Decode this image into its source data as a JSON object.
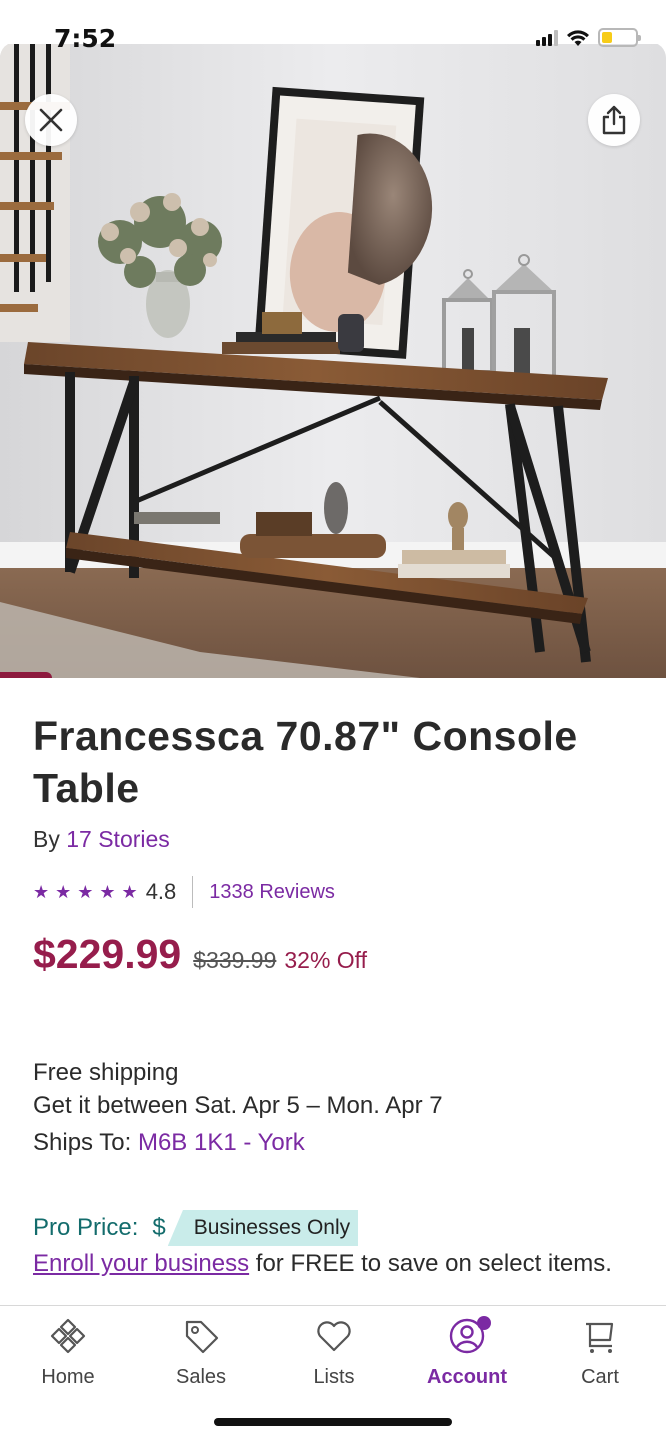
{
  "status_bar": {
    "time": "7:52",
    "battery_level": 0.3
  },
  "hero": {
    "image_icon": "product-photo",
    "close_icon": "close-icon",
    "share_icon": "share-icon"
  },
  "product": {
    "title": "Francessca 70.87\" Console Table",
    "by_label": "By",
    "brand": "17 Stories",
    "stars": "★★★★★",
    "rating": "4.8",
    "rating_value": 4.8,
    "reviews": "1338 Reviews",
    "price": "$229.99",
    "old_price": "$339.99",
    "discount": "32% Off"
  },
  "shipping": {
    "free": "Free shipping",
    "delivery": "Get it between Sat. Apr 5 – Mon. Apr 7",
    "ships_to_label": "Ships To:",
    "ships_to_value": "M6B 1K1 - York"
  },
  "pro": {
    "label": "Pro Price:",
    "dollar": "$",
    "badge": "Businesses Only",
    "enroll_link": "Enroll your business",
    "enroll_text": " for FREE to save on select items."
  },
  "nav": {
    "items": [
      {
        "label": "Home",
        "icon": "home-icon"
      },
      {
        "label": "Sales",
        "icon": "tag-icon"
      },
      {
        "label": "Lists",
        "icon": "heart-icon"
      },
      {
        "label": "Account",
        "icon": "account-icon",
        "active": true
      },
      {
        "label": "Cart",
        "icon": "cart-icon"
      }
    ]
  },
  "colors": {
    "accent_purple": "#7b2aa3",
    "price_red": "#961d4c",
    "pro_teal": "#136c6c",
    "badge_bg": "#c9ecea"
  }
}
